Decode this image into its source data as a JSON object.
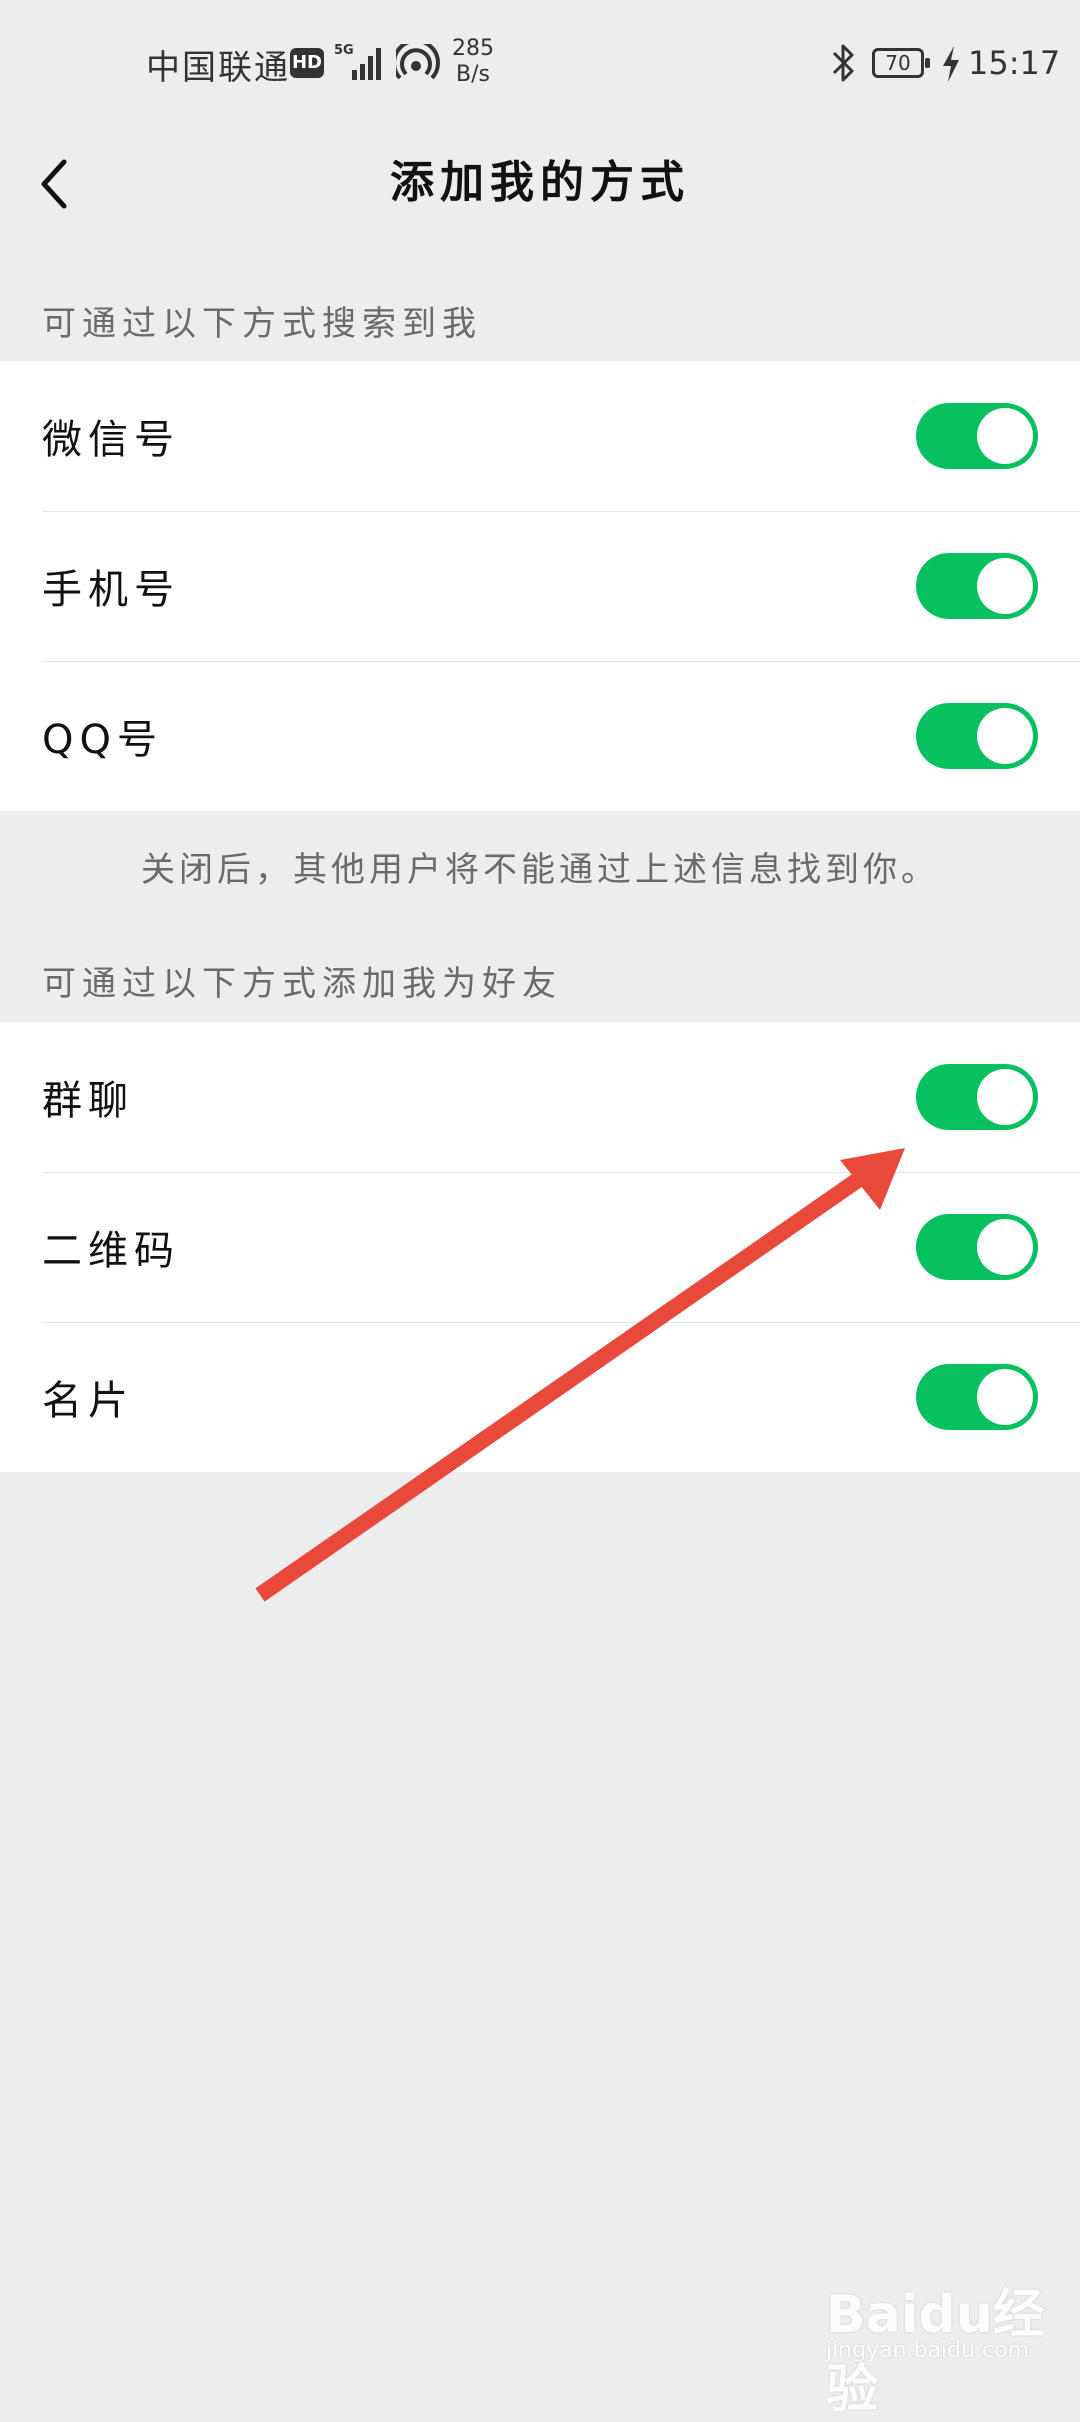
{
  "status_bar": {
    "carrier": "中国联通",
    "hd_badge": "HD",
    "network_type": "5G",
    "net_speed_value": "285",
    "net_speed_unit": "B/s",
    "battery_level": "70",
    "time": "15:17",
    "icons": [
      "hd-icon",
      "signal-icon",
      "hotspot-icon",
      "bluetooth-icon",
      "battery-icon",
      "charging-icon"
    ]
  },
  "header": {
    "title": "添加我的方式",
    "back_icon": "back-icon"
  },
  "search_section": {
    "header": "可通过以下方式搜索到我",
    "items": [
      {
        "label": "微信号",
        "enabled": true
      },
      {
        "label": "手机号",
        "enabled": true
      },
      {
        "label": "QQ号",
        "enabled": true
      }
    ],
    "note": "关闭后，其他用户将不能通过上述信息找到你。"
  },
  "add_section": {
    "header": "可通过以下方式添加我为好友",
    "items": [
      {
        "label": "群聊",
        "enabled": true
      },
      {
        "label": "二维码",
        "enabled": true
      },
      {
        "label": "名片",
        "enabled": true
      }
    ]
  },
  "colors": {
    "background": "#ededed",
    "toggle_on": "#07c160",
    "annotation_arrow": "#e8493a"
  },
  "watermark": {
    "main": "Baidu经验",
    "sub": "jingyan.baidu.com"
  }
}
